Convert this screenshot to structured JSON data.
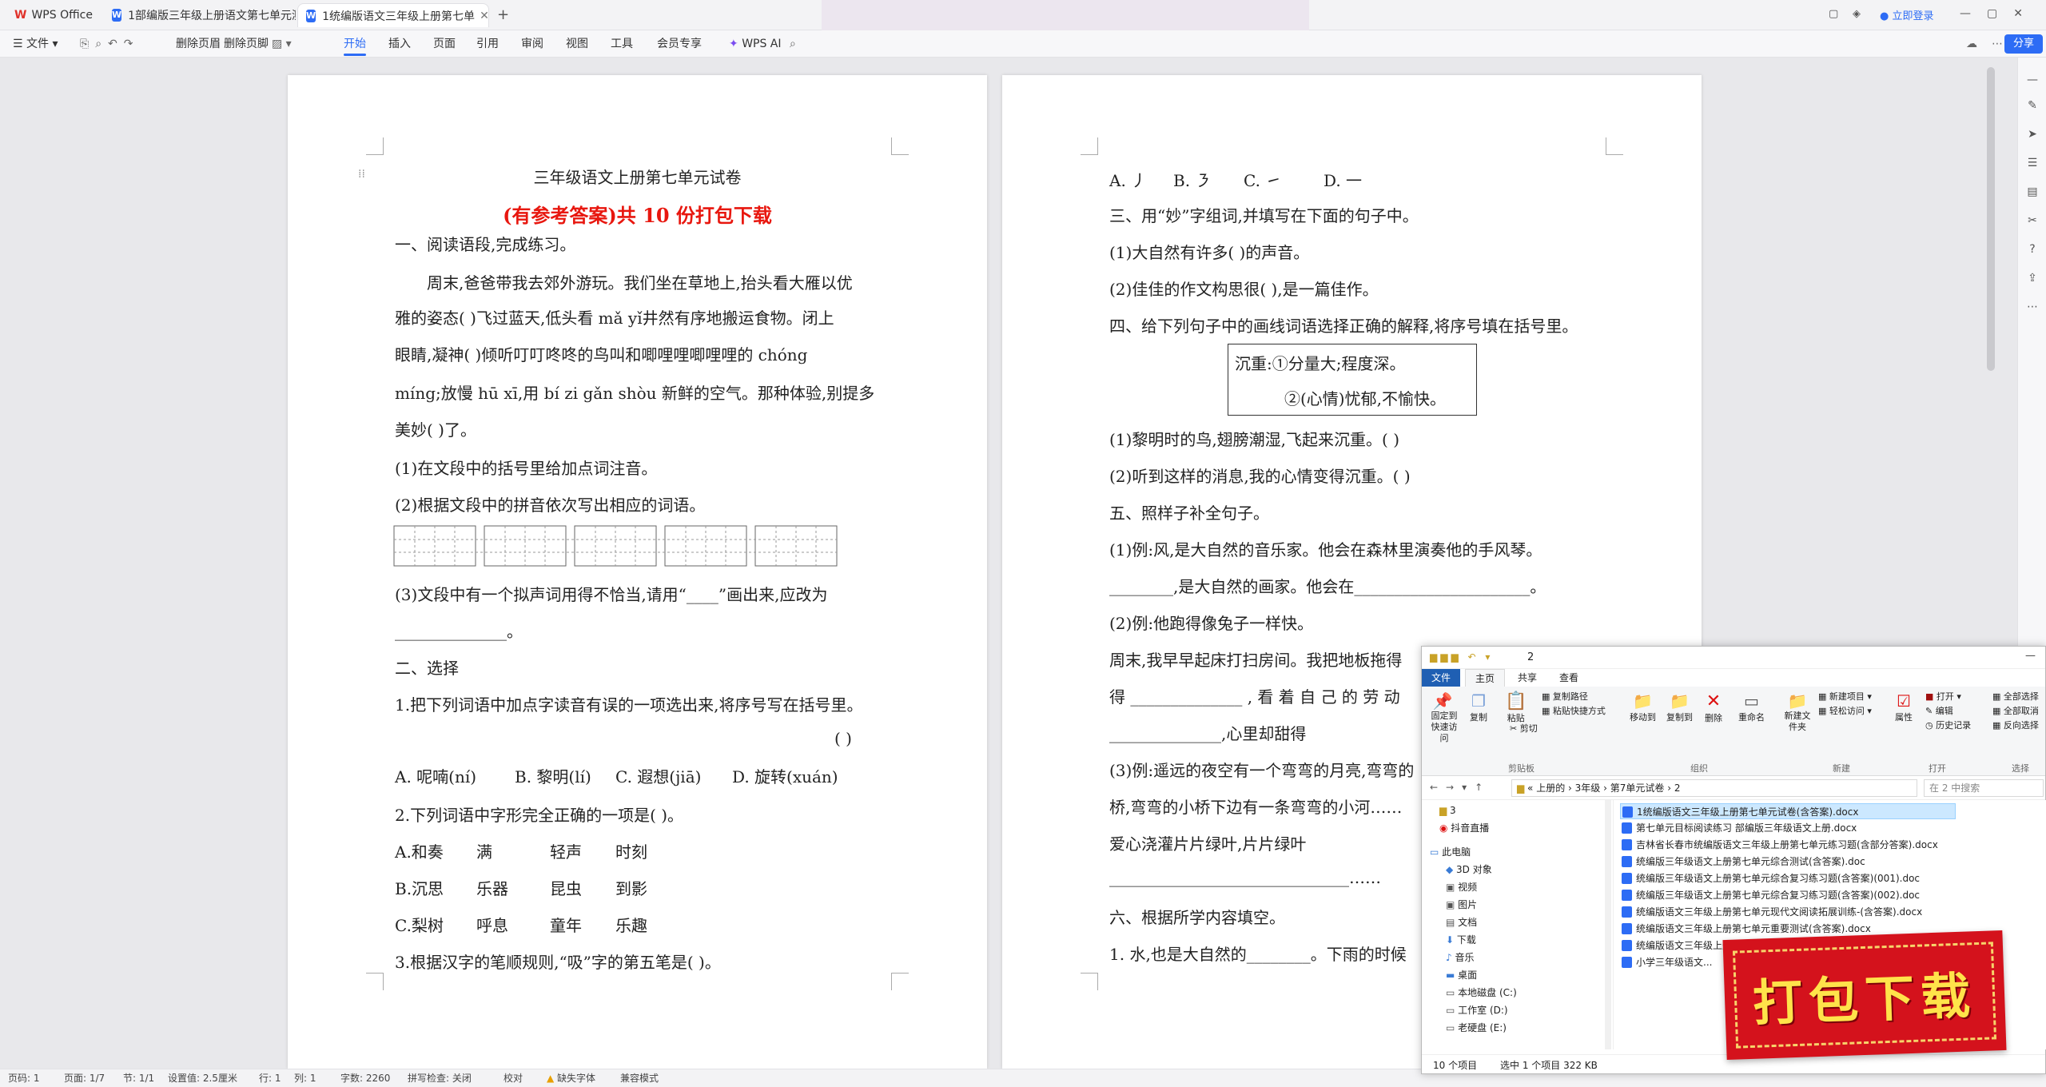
{
  "tabs": {
    "wps": "WPS Office",
    "doc1": "1部编版三年级上册语文第七单元测试",
    "doc2": "1统编版语文三年级上册第七单",
    "login": "立即登录"
  },
  "menu": {
    "file": "文件",
    "delete_header": "删除页眉",
    "delete_footer": "删除页脚",
    "start": "开始",
    "insert": "插入",
    "page": "页面",
    "reference": "引用",
    "review": "审阅",
    "view": "视图",
    "tools": "工具",
    "member": "会员专享",
    "wps_ai": "WPS AI",
    "share": "分享"
  },
  "page1": {
    "title": "三年级语文上册第七单元试卷",
    "subtitle": "(有参考答案)共 10 份打包下载",
    "s1": "一、阅读语段,完成练习。",
    "p1a": "周末,爸爸带我去郊外游玩。我们坐在草地上,抬头看大雁以优",
    "p1b": "雅的姿态(          )飞过蓝天,低头看 mǎ yǐ井然有序地搬运食物。闭上",
    "p1c": "眼睛,凝神(            )倾听叮叮咚咚的鸟叫和唧哩哩唧哩哩的 chóng",
    "p1d": "míng;放慢 hū xī,用 bí zi  gǎn shòu 新鲜的空气。那种体验,别提多",
    "p1e": "美妙(          )了。",
    "q1": "(1)在文段中的括号里给加点词注音。",
    "q2": "(2)根据文段中的拼音依次写出相应的词语。",
    "q3": "(3)文段中有一个拟声词用得不恰当,请用“____”画出来,应改为",
    "q3b": "______________。",
    "s2": "二、选择",
    "c1": "1.把下列词语中加点字读音有误的一项选出来,将序号写在括号里。",
    "c1p": "(    )",
    "c1a": "A. 呢喃(ní)",
    "c1b": "B. 黎明(lí)",
    "c1c": "C. 遐想(jiā)",
    "c1d": "D. 旋转(xuán)",
    "c2": "2.下列词语中字形完全正确的一项是(       )。",
    "c2a": [
      "A.和奏",
      "满",
      "轻声",
      "时刻"
    ],
    "c2b": [
      "B.沉思",
      "乐器",
      "昆虫",
      "到影"
    ],
    "c2c": [
      "C.梨树",
      "呼息",
      "童年",
      "乐趣"
    ],
    "c3": "3.根据汉字的笔顺规则,“吸”字的第五笔是(       )。"
  },
  "page2": {
    "opts": [
      "A. 丿",
      "B. ㇋",
      "C. ㇀",
      "D. 一"
    ],
    "s3": "三、用“妙”字组词,并填写在下面的句子中。",
    "s3a": "(1)大自然有许多(            )的声音。",
    "s3b": "(2)佳佳的作文构思很(            ),是一篇佳作。",
    "s4": "四、给下列句子中的画线词语选择正确的解释,将序号填在括号里。",
    "box_label": "沉重:",
    "box1": "①分量大;程度深。",
    "box2": "②(心情)忧郁,不愉快。",
    "s4a": "(1)黎明时的鸟,翅膀潮湿,飞起来沉重。(          )",
    "s4b": "(2)听到这样的消息,我的心情变得沉重。(          )",
    "s5": "五、照样子补全句子。",
    "s5a": "(1)例:风,是大自然的音乐家。他会在森林里演奏他的手风琴。",
    "s5b": "________,是大自然的画家。他会在______________________。",
    "s5c": "(2)例:他跑得像兔子一样快。",
    "s5d": "周末,我早早起床打扫房间。我把地板拖得",
    "s5e": "得  ______________  ,  看  着  自  己  的  劳  动",
    "s5f": "______________,心里却甜得",
    "s5g": "(3)例:遥远的夜空有一个弯弯的月亮,弯弯的",
    "s5h": "桥,弯弯的小桥下边有一条弯弯的小河……",
    "s5i": "爱心浇灌片片绿叶,片片绿叶",
    "s5j": "______________________________……",
    "s6": "六、根据所学内容填空。",
    "s6a": "1. 水,也是大自然的________。下雨的时候"
  },
  "explorer": {
    "title": "2",
    "tabs": [
      "文件",
      "主页",
      "共享",
      "查看"
    ],
    "ribbon": {
      "pin": "固定到快速访问",
      "copy": "复制",
      "paste": "粘贴",
      "copy_path": "复制路径",
      "paste_shortcut": "粘贴快捷方式",
      "cut": "剪切",
      "clipboard": "剪贴板",
      "move_to": "移动到",
      "copy_to": "复制到",
      "delete": "删除",
      "rename": "重命名",
      "organize": "组织",
      "new_folder": "新建文件夹",
      "new_item": "新建项目",
      "easy_access": "轻松访问",
      "new": "新建",
      "properties": "属性",
      "open": "打开",
      "edit": "编辑",
      "history": "历史记录",
      "open_grp": "打开",
      "select_all": "全部选择",
      "select_none": "全部取消",
      "invert": "反向选择",
      "select_grp": "选择"
    },
    "path": [
      "上册的",
      "3年级",
      "第7单元试卷",
      "2"
    ],
    "search": "在 2 中搜索",
    "nav": [
      "3",
      "抖音直播",
      "此电脑",
      "3D 对象",
      "视频",
      "图片",
      "文档",
      "下载",
      "音乐",
      "桌面",
      "本地磁盘 (C:)",
      "工作室 (D:)",
      "老硬盘 (E:)"
    ],
    "files": [
      "1统编版语文三年级上册第七单元试卷(含答案).docx",
      "第七单元目标阅读练习  部编版三年级语文上册.docx",
      "吉林省长春市统编版语文三年级上册第七单元练习题(含部分答案).docx",
      "统编版三年级语文上册第七单元综合测试(含答案).doc",
      "统编版三年级语文上册第七单元综合复习练习题(含答案)(001).doc",
      "统编版三年级语文上册第七单元综合复习练习题(含答案)(002).doc",
      "统编版语文三年级上册第七单元现代文阅读拓展训练-(含答案).docx",
      "统编版语文三年级上册第七单元重要测试(含答案).docx",
      "统编版语文三年级上册第七单元...",
      "小学三年级语文..."
    ],
    "status_count": "10 个项目",
    "status_sel": "选中 1 个项目  322 KB"
  },
  "promo": "打包下载",
  "status": {
    "page": "页码: 1",
    "pages": "页面: 1/7",
    "section": "节: 1/1",
    "setting": "设置值: 2.5厘米",
    "row": "行: 1",
    "col": "列: 1",
    "words": "字数: 2260",
    "spell": "拼写检查: 关闭",
    "proof": "校对",
    "missing_font": "缺失字体",
    "compat": "兼容模式"
  }
}
